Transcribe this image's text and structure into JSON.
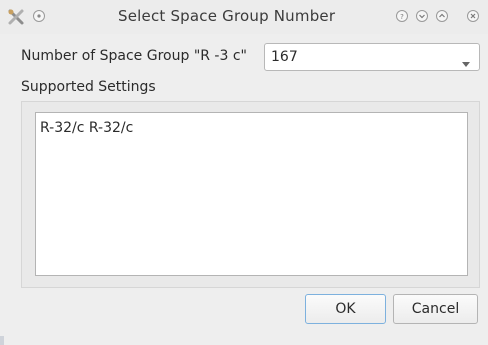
{
  "window": {
    "title": "Select Space Group Number",
    "app_icon": "tools-icon",
    "controls": [
      "help-icon",
      "minimize-icon",
      "maximize-icon",
      "close-icon"
    ]
  },
  "space_group": {
    "label": "Number of Space Group \"R -3 c\"",
    "selected_value": "167"
  },
  "settings": {
    "label": "Supported Settings",
    "content": "R-32/c R-32/c"
  },
  "buttons": {
    "ok_label": "OK",
    "cancel_label": "Cancel"
  }
}
